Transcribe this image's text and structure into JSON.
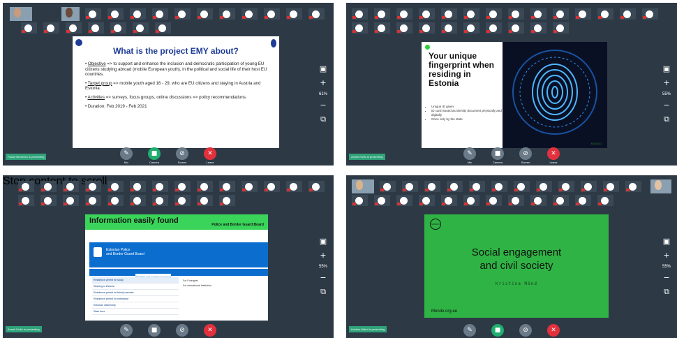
{
  "panels": [
    {
      "zoom": "61%",
      "status": "Paula Sarmento is presenting",
      "controls": [
        "Mic",
        "Camera",
        "Screen",
        "Leave"
      ],
      "slide": {
        "title": "What is the project EMY about?",
        "bullets": [
          {
            "label": "Objective",
            "text": " => to support and enhance the inclusion and democratic participation of young EU citizens studying abroad (mobile European youth), in the political and social life of their host EU countries."
          },
          {
            "label": "Target group",
            "text": " => mobile youth aged 16 - 29, who are EU citizens and staying in Austria and Estonia."
          },
          {
            "label": "Activities",
            "text": " => surveys, focus groups, online discussions => policy recommendations."
          },
          {
            "label": "",
            "text": "Duration: Feb 2019 - Feb 2021"
          }
        ]
      }
    },
    {
      "zoom": "55%",
      "status": "Anneli Kivilo is presenting",
      "controls": [
        "Mic",
        "Camera",
        "Screen",
        "Leave"
      ],
      "slide": {
        "title": "Your unique fingerprint when residing in Estonia",
        "bullets": [
          "Unique ID given",
          "ID card issued as identity document physically and digitally",
          "Once only by the state"
        ],
        "logo": "MONDO"
      }
    },
    {
      "zoom": "55%",
      "status": "Anneli Kivilo is presenting",
      "tooltip": "Stop content to scroll",
      "slide": {
        "title": "Information easily found",
        "subtitle": "Police and Border Guard Board",
        "site_name_1": "Estonian Police",
        "site_name_2": "and Border Guard Board",
        "nav": [
          "About",
          "Documents and permits",
          "Residing and working in Estonia",
          "Police work",
          "Borders and sea",
          "Locations",
          "Contact details"
        ],
        "menu": [
          "Residence permit for study",
          "Working in Estonia",
          "Residence permit for family member",
          "Residence permit for enterprise",
          "Estonian citizenship",
          "State fees"
        ],
        "right_links": [
          "For Foreigner",
          "For educational institution"
        ]
      }
    },
    {
      "zoom": "55%",
      "status": "Kristina Mänd is presenting",
      "slide": {
        "logo": "MONDO",
        "title_line1": "Social engagement",
        "title_line2": "and civil society",
        "speaker": "Kristina Mänd",
        "site": "Mondo.org.ee"
      }
    }
  ]
}
